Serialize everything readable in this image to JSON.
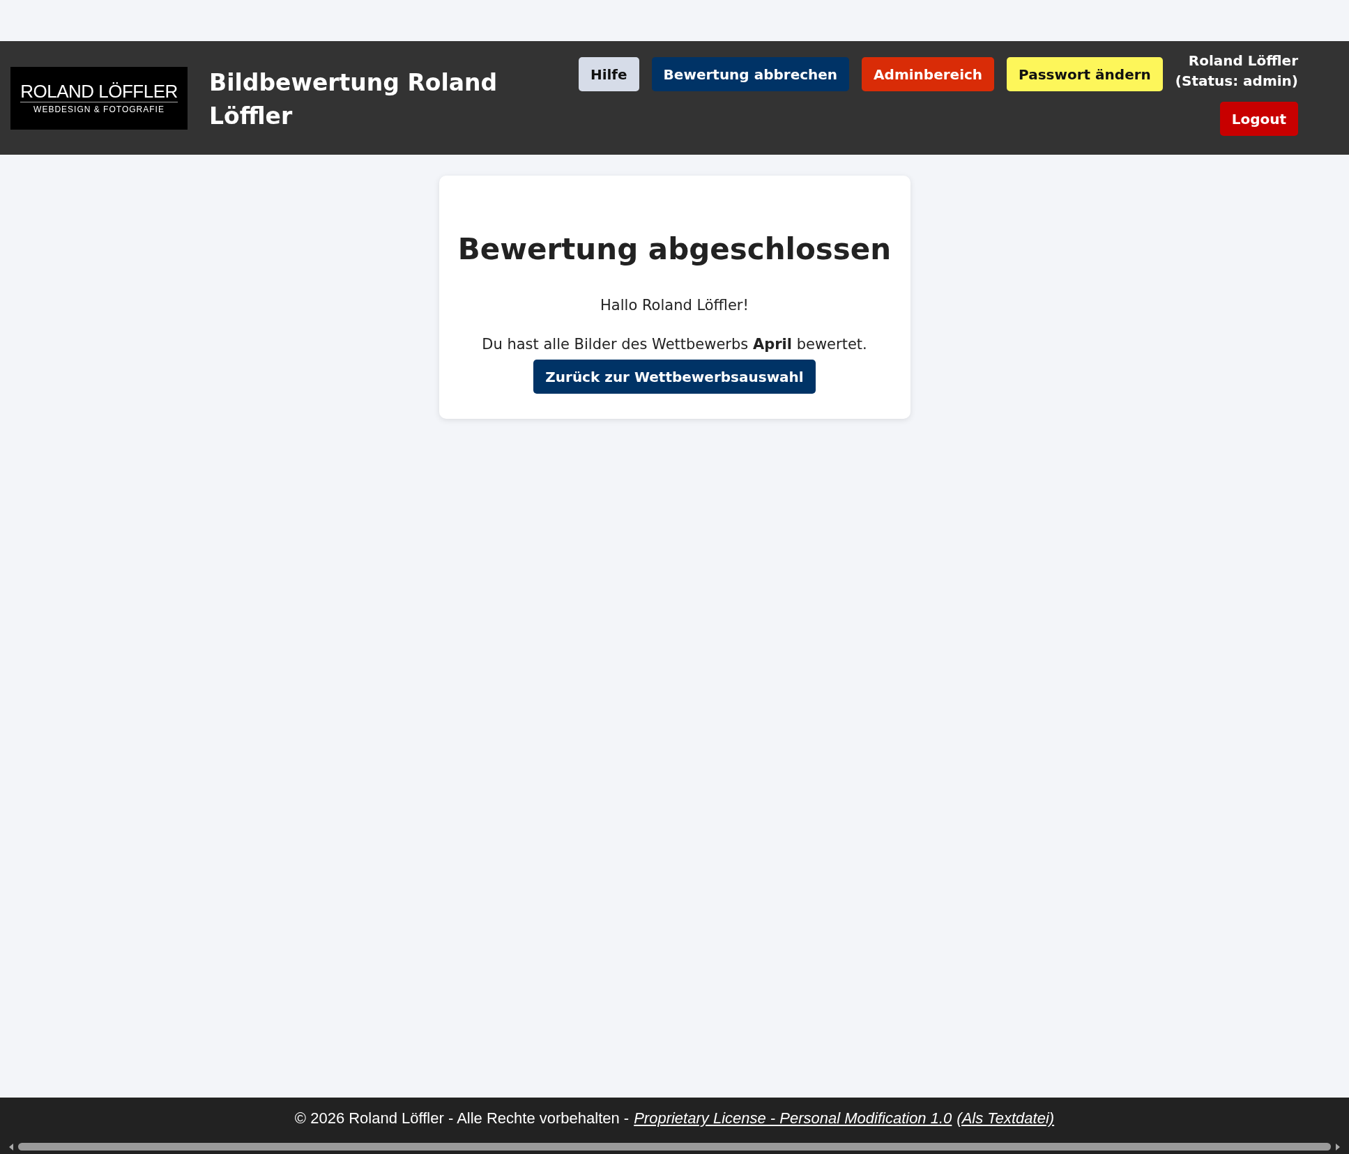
{
  "logo": {
    "name": "ROLAND LÖFFLER",
    "tagline": "WEBDESIGN & FOTOGRAFIE"
  },
  "header": {
    "title": "Bildbewertung Roland Löffler",
    "buttons": [
      {
        "label": "Hilfe",
        "kind": "light"
      },
      {
        "label": "Bewertung abbrechen",
        "kind": "primary"
      },
      {
        "label": "Adminbereich",
        "kind": "admin"
      },
      {
        "label": "Passwort ändern",
        "kind": "warning"
      }
    ],
    "user": {
      "name": "Roland Löffler",
      "status": "(Status: admin)",
      "logout": "Logout"
    }
  },
  "card": {
    "heading": "Bewertung abgeschlossen",
    "greeting": "Hallo Roland Löffler!",
    "message": "Du hast alle Bilder des Wettbewerbs **April** bewertet.",
    "button": "Zurück zur Wettbewerbsauswahl"
  },
  "footer": {
    "text": "© 2026 Roland Löffler - Alle Rechte vorbehalten -",
    "links": [
      "Proprietary License - Personal Modification 1.0",
      "(Als Textdatei)"
    ]
  }
}
